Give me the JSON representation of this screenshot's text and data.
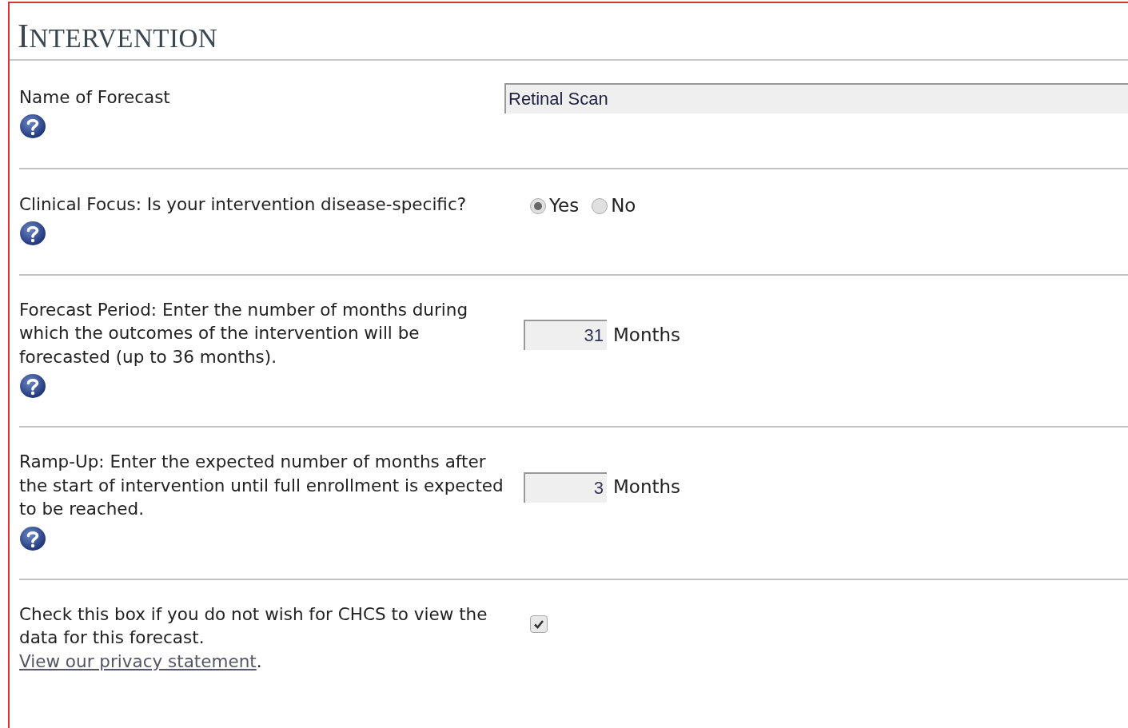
{
  "section": {
    "title": "INTERVENTION"
  },
  "rows": [
    {
      "kind": "text",
      "label": "Name of Forecast",
      "help": true,
      "value": "Retinal Scan"
    },
    {
      "kind": "radio",
      "label": "Clinical Focus: Is your intervention disease-specific?",
      "help": true,
      "options": [
        {
          "label": "Yes",
          "selected": true
        },
        {
          "label": "No",
          "selected": false
        }
      ]
    },
    {
      "kind": "number",
      "label": "Forecast Period: Enter the number of months during which the outcomes of the intervention will be forecasted (up to 36 months).",
      "help": true,
      "value": "31",
      "unit": "Months"
    },
    {
      "kind": "number",
      "label": "Ramp-Up: Enter the expected number of months after the start of intervention until full enrollment is expected to be reached.",
      "help": true,
      "value": "3",
      "unit": "Months"
    },
    {
      "kind": "checkbox",
      "label": "Check this box if you do not wish for CHCS to view the data for this forecast.",
      "link": "View our privacy statement",
      "link_suffix": ".",
      "help": false,
      "checked": true
    }
  ]
}
